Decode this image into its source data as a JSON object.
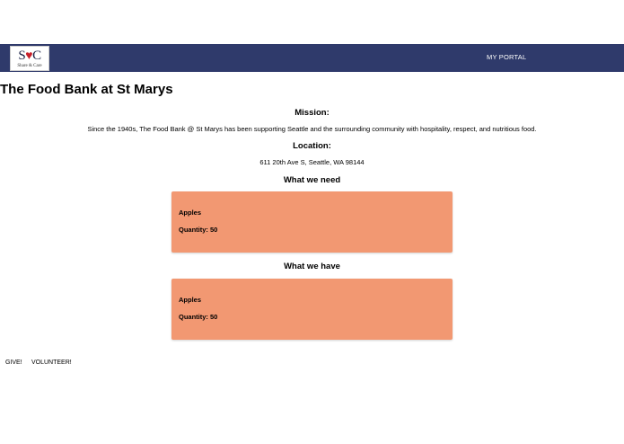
{
  "navbar": {
    "logo": {
      "mark_left": "S",
      "mark_heart": "♥",
      "mark_right": "C",
      "tagline": "Share & Care"
    },
    "portal_label": "MY PORTAL",
    "background": "#2f3a6b"
  },
  "page": {
    "title": "The Food Bank at St Marys"
  },
  "mission": {
    "heading": "Mission:",
    "text": "Since the 1940s, The Food Bank @ St Marys has been supporting Seattle and the surrounding community with hospitality, respect, and nutritious food."
  },
  "location": {
    "heading": "Location:",
    "text": "611 20th Ave S, Seattle, WA 98144"
  },
  "needs": {
    "heading": "What we need",
    "items": [
      {
        "name": "Apples",
        "quantity": "Quantity: 50"
      }
    ]
  },
  "have": {
    "heading": "What we have",
    "items": [
      {
        "name": "Apples",
        "quantity": "Quantity: 50"
      }
    ]
  },
  "footer": {
    "give_label": "GIVE!",
    "volunteer_label": "VOLUNTEER!"
  },
  "colors": {
    "card": "#f29872",
    "heart": "#c61f2b"
  },
  "icons": {
    "logo_heart": "heart-icon"
  }
}
